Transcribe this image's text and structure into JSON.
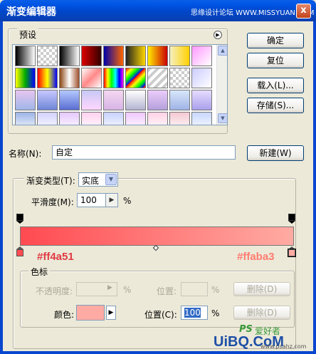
{
  "window": {
    "title": "渐变编辑器",
    "watermark_top": "思缘设计论坛 WWW.MISSYUAN.COM",
    "close_label": "x"
  },
  "presets": {
    "label": "预设",
    "menu_icon": "▶"
  },
  "presets_swatches": [
    [
      "linear-gradient(90deg,#000,#fff)",
      "repeating-conic-gradient(#ccc 0 25%,#fff 0 50%) 0 0/8px 8px",
      "linear-gradient(90deg,#000,#fff)",
      "linear-gradient(90deg,#d00,#300)",
      "linear-gradient(90deg,#00a,#f60)",
      "linear-gradient(90deg,#222,#ffd700)",
      "linear-gradient(90deg,#ffec00,#c00)",
      "linear-gradient(90deg,#f5f0c0,#ffd000)",
      "linear-gradient(135deg,#f9f,#fff)"
    ],
    [
      "linear-gradient(90deg,#ff0,#0a0,#00f)",
      "linear-gradient(90deg,#f00,#ff0,#00f)",
      "linear-gradient(90deg,#8b4513,#fff,#a0522d)",
      "linear-gradient(135deg,#fff,#f88,#fff)",
      "linear-gradient(90deg,#f00,#ff0,#0f0,#0ff,#00f,#f0f)",
      "repeating-linear-gradient(135deg,#f00,#ff0 6px,#0f0 12px,#00f 18px)",
      "repeating-linear-gradient(135deg,#ccc 0 4px,#fff 4px 8px)",
      "repeating-conic-gradient(#ccc 0 25%,#fff 0 50%) 0 0/8px 8px",
      "linear-gradient(135deg,#ccf,#fff)"
    ],
    [
      "linear-gradient(180deg,#e7c5f0,#9fb6e8)",
      "linear-gradient(180deg,#c8c8ff,#6e86d6)",
      "linear-gradient(180deg,#b4c8ff,#5a6ed2)",
      "linear-gradient(180deg,#c8c8f5,#ffd7ff)",
      "linear-gradient(180deg,#f5d7f0,#d7b4e6)",
      "linear-gradient(180deg,#fff,#b4b4d2)",
      "linear-gradient(180deg,#ebcdfa,#b4a0dc)",
      "linear-gradient(180deg,#d7e6fa,#a0b4e6)",
      "linear-gradient(180deg,#e6dcff,#aaa0eb)"
    ],
    [
      "linear-gradient(180deg,#9bb4e6,#fff)",
      "linear-gradient(180deg,#d2d2ff,#fff)",
      "linear-gradient(180deg,#e6c8ff,#fff)",
      "linear-gradient(180deg,#ffd2f0,#fff)",
      "linear-gradient(180deg,#c8d2ff,#fff)",
      "linear-gradient(180deg,#f0c8ff,#fff)",
      "linear-gradient(180deg,#ffd2e6,#fff)",
      "linear-gradient(180deg,#f5c8d2,#fff)",
      "linear-gradient(180deg,#c8d7ff,#fff)"
    ]
  ],
  "buttons": {
    "ok": "确定",
    "reset": "复位",
    "load": "载入(L)...",
    "save": "存储(S)...",
    "new": "新建(W)"
  },
  "name": {
    "label": "名称(N):",
    "value": "自定"
  },
  "gradient_type": {
    "label": "渐变类型(T):",
    "value": "实底"
  },
  "smoothness": {
    "label": "平滑度(M):",
    "value": "100",
    "unit": "%"
  },
  "gradient": {
    "start_color": "#ff4a51",
    "end_color": "#ffaba3",
    "start_hex": "#ff4a51",
    "end_hex": "#ffaba3",
    "midpoint_percent": 50
  },
  "color_stops": {
    "label": "色标",
    "opacity_label": "不透明度:",
    "opacity_unit": "%",
    "opacity_location_label": "位置:",
    "opacity_location_unit": "%",
    "opacity_delete": "删除(D)",
    "color_label": "颜色:",
    "color_value": "#ffaba3",
    "color_location_label": "位置(C):",
    "color_location_value": "100",
    "color_location_unit": "%",
    "color_delete": "删除(D)"
  },
  "watermark_bottom": {
    "text": "UiBQ.CoM",
    "ps": "PS",
    "cn": "爱好者",
    "url": "www.psahz.com"
  },
  "colors": {
    "title_bar": "#0055e5",
    "dialog_bg": "#ece9d8",
    "hex_start": "#e03a44",
    "hex_end": "#ff7b70"
  }
}
